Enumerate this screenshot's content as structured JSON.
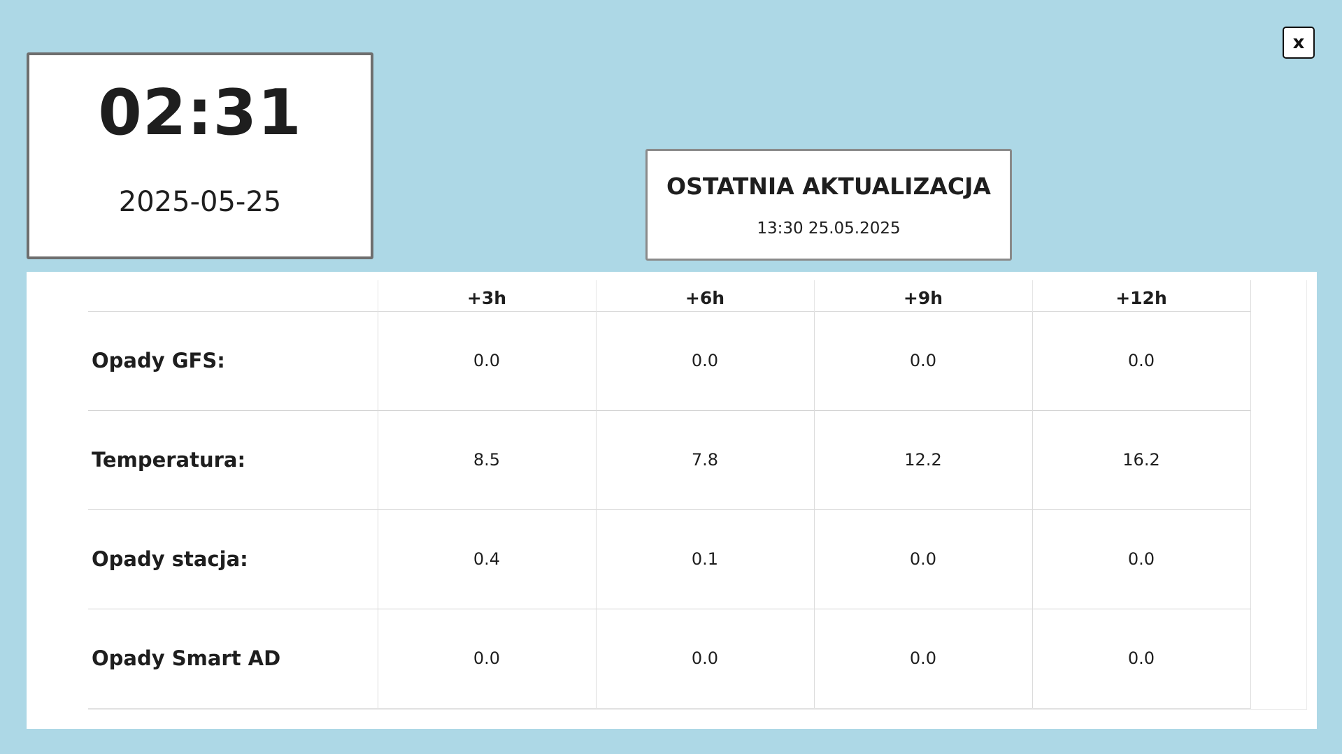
{
  "clock": {
    "time": "02:31",
    "date": "2025-05-25"
  },
  "update": {
    "title": "OSTATNIA AKTUALIZACJA",
    "timestamp": "13:30 25.05.2025"
  },
  "close_button": {
    "label": "x"
  },
  "forecast_table": {
    "columns": [
      "+3h",
      "+6h",
      "+9h",
      "+12h"
    ],
    "rows": [
      {
        "label": "Opady GFS:",
        "values": [
          "0.0",
          "0.0",
          "0.0",
          "0.0"
        ]
      },
      {
        "label": "Temperatura:",
        "values": [
          "8.5",
          "7.8",
          "12.2",
          "16.2"
        ]
      },
      {
        "label": "Opady stacja:",
        "values": [
          "0.4",
          "0.1",
          "0.0",
          "0.0"
        ]
      },
      {
        "label": "Opady Smart AD",
        "values": [
          "0.0",
          "0.0",
          "0.0",
          "0.0"
        ]
      }
    ]
  },
  "colors": {
    "background": "#add8e6",
    "panel": "#ffffff",
    "text": "#1e1e1e"
  }
}
